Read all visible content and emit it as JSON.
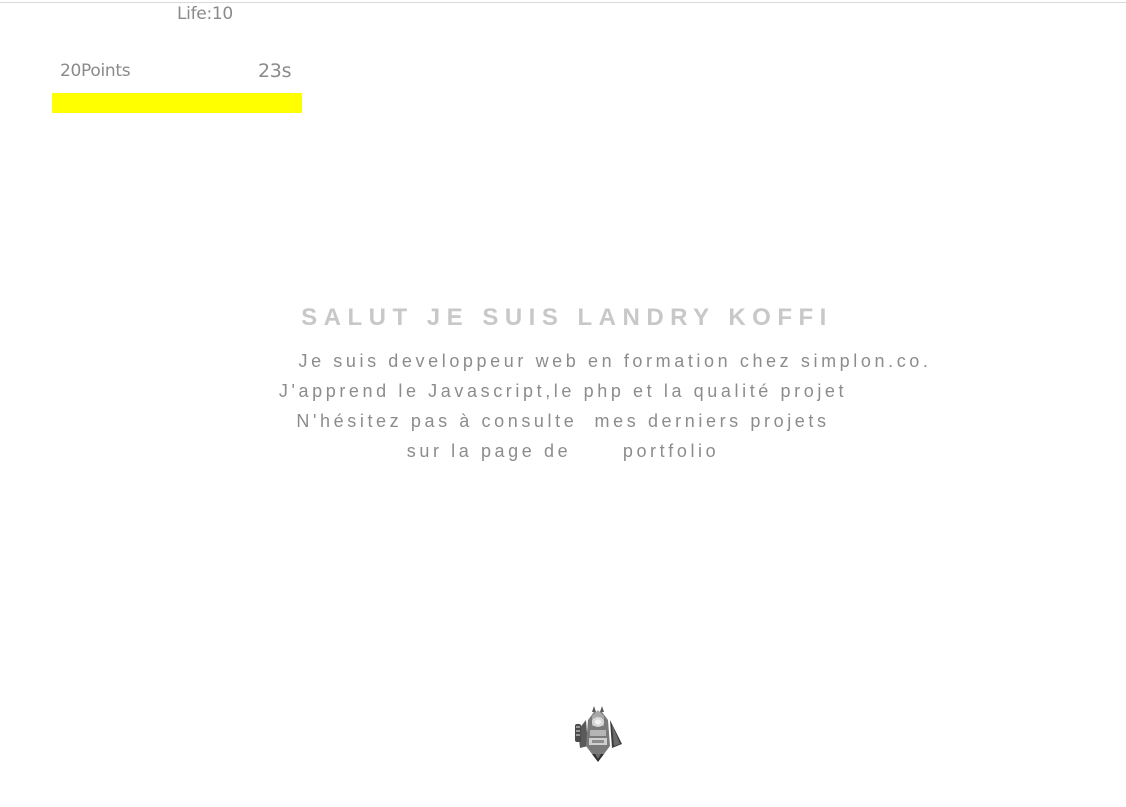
{
  "hud": {
    "life": "Life:10",
    "points": "20Points",
    "timer": "23s",
    "progress": 1.0,
    "progress_color": "#ffff00"
  },
  "intro": {
    "headline": "SALUT JE SUIS LANDRY KOFFI",
    "line1": "Je suis developpeur web en formation chez simplon.co.",
    "line2": "J'apprend le Javascript,le php et la qualité projet",
    "line3": "N'hésitez pas à consulte  mes derniers projets",
    "line4_prefix": "sur la page de",
    "line4_link": "portfolio"
  },
  "player": {
    "icon": "spaceship-icon"
  }
}
